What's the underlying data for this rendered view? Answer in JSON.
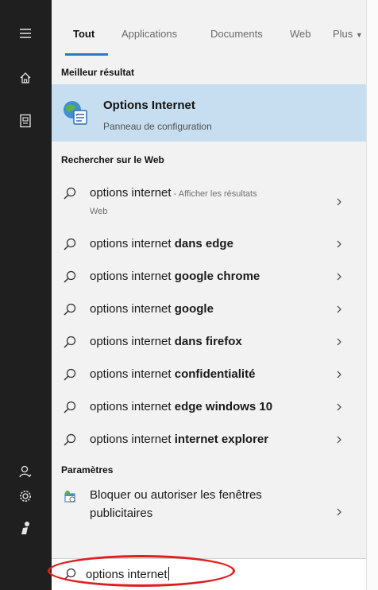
{
  "tabs": [
    {
      "label": "Tout",
      "active": true
    },
    {
      "label": "Applications"
    },
    {
      "label": "Documents"
    },
    {
      "label": "Web"
    },
    {
      "label": "Plus"
    }
  ],
  "best_result": {
    "header": "Meilleur résultat",
    "title": "Options Internet",
    "subtitle": "Panneau de configuration"
  },
  "web": {
    "header": "Rechercher sur le Web",
    "first": {
      "query": "options internet",
      "suffix": " - Afficher les résultats",
      "sub": "Web"
    },
    "items": [
      {
        "base": "options internet",
        "bold": "dans edge"
      },
      {
        "base": "options internet",
        "bold": "google chrome"
      },
      {
        "base": "options internet",
        "bold": "google"
      },
      {
        "base": "options internet",
        "bold": "dans firefox"
      },
      {
        "base": "options internet",
        "bold": "confidentialité"
      },
      {
        "base": "options internet",
        "bold": "edge windows 10"
      },
      {
        "base": "options internet",
        "bold": "internet explorer"
      }
    ]
  },
  "settings": {
    "header": "Paramètres",
    "item_line1": "Bloquer ou autoriser les fenêtres",
    "item_line2": "publicitaires"
  },
  "search": {
    "value": "options internet"
  },
  "colors": {
    "accent": "#2f78c4",
    "highlight": "#c7def1",
    "rail": "#1f1f1f",
    "annotation": "#e01e1e"
  }
}
